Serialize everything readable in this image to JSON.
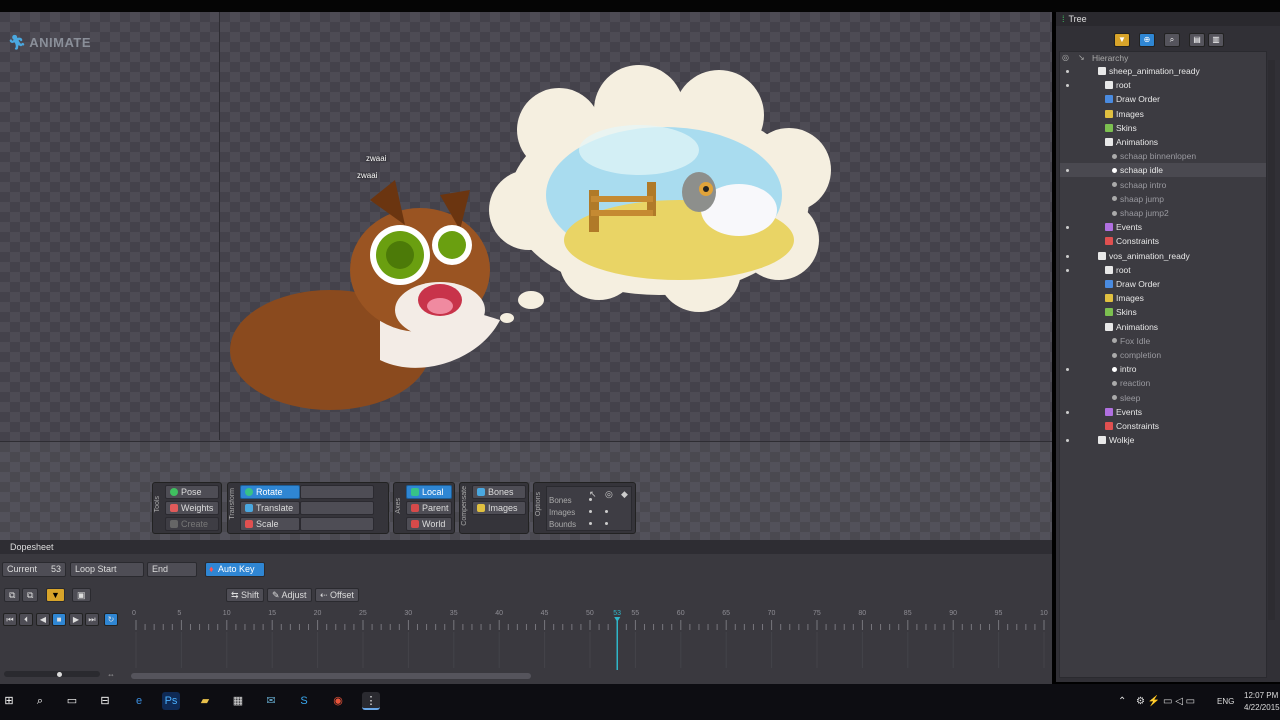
{
  "app": {
    "brand": "ANIMATE"
  },
  "viewport": {
    "speech": [
      "zwaai",
      "zwaai"
    ]
  },
  "tools": {
    "label": "Tools",
    "pose": "Pose",
    "weights": "Weights",
    "create": "Create"
  },
  "transform": {
    "label": "Transform",
    "rotate": "Rotate",
    "translate": "Translate",
    "scale": "Scale"
  },
  "axes": {
    "label": "Axes",
    "local": "Local",
    "parent": "Parent",
    "world": "World"
  },
  "compensate": {
    "label": "Compensate",
    "bones": "Bones",
    "images": "Images"
  },
  "options": {
    "label": "Options",
    "rows": [
      "Bones",
      "Images",
      "Bounds"
    ]
  },
  "tree": {
    "title": "Tree",
    "section": "Hierarchy",
    "rows": [
      {
        "label": "sheep_animation_ready",
        "icon": "skeleton-icon",
        "color": "#e8e8e8",
        "depth": 2,
        "dot": true,
        "dim": false
      },
      {
        "label": "root",
        "icon": "bone-icon",
        "color": "#e8e8e8",
        "depth": 3,
        "dot": true,
        "dim": false
      },
      {
        "label": "Draw Order",
        "icon": "draw-order-icon",
        "color": "#4a8be0",
        "depth": 3,
        "dot": false,
        "dim": false
      },
      {
        "label": "Images",
        "icon": "images-icon",
        "color": "#e0c040",
        "depth": 3,
        "dot": false,
        "dim": false
      },
      {
        "label": "Skins",
        "icon": "skins-icon",
        "color": "#7cc050",
        "depth": 3,
        "dot": false,
        "dim": false
      },
      {
        "label": "Animations",
        "icon": "animations-icon",
        "color": "#e8e8e8",
        "depth": 3,
        "dot": false,
        "dim": false
      },
      {
        "label": "schaap binnenlopen",
        "icon": "animation-icon",
        "color": "#aaa",
        "depth": 4,
        "dot": false,
        "dim": true
      },
      {
        "label": "schaap idle",
        "icon": "animation-icon",
        "color": "#fff",
        "depth": 4,
        "dot": true,
        "dim": false,
        "selected": true
      },
      {
        "label": "schaap intro",
        "icon": "animation-icon",
        "color": "#aaa",
        "depth": 4,
        "dot": false,
        "dim": true
      },
      {
        "label": "shaap jump",
        "icon": "animation-icon",
        "color": "#aaa",
        "depth": 4,
        "dot": false,
        "dim": true
      },
      {
        "label": "shaap jump2",
        "icon": "animation-icon",
        "color": "#aaa",
        "depth": 4,
        "dot": false,
        "dim": true
      },
      {
        "label": "Events",
        "icon": "events-icon",
        "color": "#b070e0",
        "depth": 3,
        "dot": true,
        "dim": false
      },
      {
        "label": "Constraints",
        "icon": "constraints-icon",
        "color": "#e05050",
        "depth": 3,
        "dot": false,
        "dim": false
      },
      {
        "label": "vos_animation_ready",
        "icon": "skeleton-icon",
        "color": "#e8e8e8",
        "depth": 2,
        "dot": true,
        "dim": false
      },
      {
        "label": "root",
        "icon": "bone-icon",
        "color": "#e8e8e8",
        "depth": 3,
        "dot": true,
        "dim": false
      },
      {
        "label": "Draw Order",
        "icon": "draw-order-icon",
        "color": "#4a8be0",
        "depth": 3,
        "dot": false,
        "dim": false
      },
      {
        "label": "Images",
        "icon": "images-icon",
        "color": "#e0c040",
        "depth": 3,
        "dot": false,
        "dim": false
      },
      {
        "label": "Skins",
        "icon": "skins-icon",
        "color": "#7cc050",
        "depth": 3,
        "dot": false,
        "dim": false
      },
      {
        "label": "Animations",
        "icon": "animations-icon",
        "color": "#e8e8e8",
        "depth": 3,
        "dot": false,
        "dim": false
      },
      {
        "label": "Fox Idle",
        "icon": "animation-icon",
        "color": "#aaa",
        "depth": 4,
        "dot": false,
        "dim": true
      },
      {
        "label": "completion",
        "icon": "animation-icon",
        "color": "#aaa",
        "depth": 4,
        "dot": false,
        "dim": true
      },
      {
        "label": "intro",
        "icon": "animation-icon",
        "color": "#fff",
        "depth": 4,
        "dot": true,
        "dim": false
      },
      {
        "label": "reaction",
        "icon": "animation-icon",
        "color": "#aaa",
        "depth": 4,
        "dot": false,
        "dim": true
      },
      {
        "label": "sleep",
        "icon": "animation-icon",
        "color": "#aaa",
        "depth": 4,
        "dot": false,
        "dim": true
      },
      {
        "label": "Events",
        "icon": "events-icon",
        "color": "#b070e0",
        "depth": 3,
        "dot": true,
        "dim": false
      },
      {
        "label": "Constraints",
        "icon": "constraints-icon",
        "color": "#e05050",
        "depth": 3,
        "dot": false,
        "dim": false
      },
      {
        "label": "Wolkje",
        "icon": "skeleton-icon",
        "color": "#e8e8e8",
        "depth": 2,
        "dot": true,
        "dim": false
      }
    ]
  },
  "dopesheet": {
    "title": "Dopesheet",
    "current_label": "Current",
    "current_value": "53",
    "loop_start_label": "Loop Start",
    "end_label": "End",
    "autokey_label": "Auto Key",
    "shift_label": "Shift",
    "adjust_label": "Adjust",
    "offset_label": "Offset",
    "ticks": [
      "0",
      "5",
      "10",
      "15",
      "20",
      "25",
      "30",
      "35",
      "40",
      "45",
      "50",
      "53",
      "55",
      "60",
      "65",
      "70",
      "75",
      "80",
      "85",
      "90",
      "95",
      "10"
    ],
    "current_frame": 53
  },
  "taskbar": {
    "lang": "ENG",
    "time": "12:07 PM",
    "date": "4/22/2015"
  },
  "colors": {
    "accent": "#2f86d3",
    "playhead": "#2fb6c9"
  }
}
